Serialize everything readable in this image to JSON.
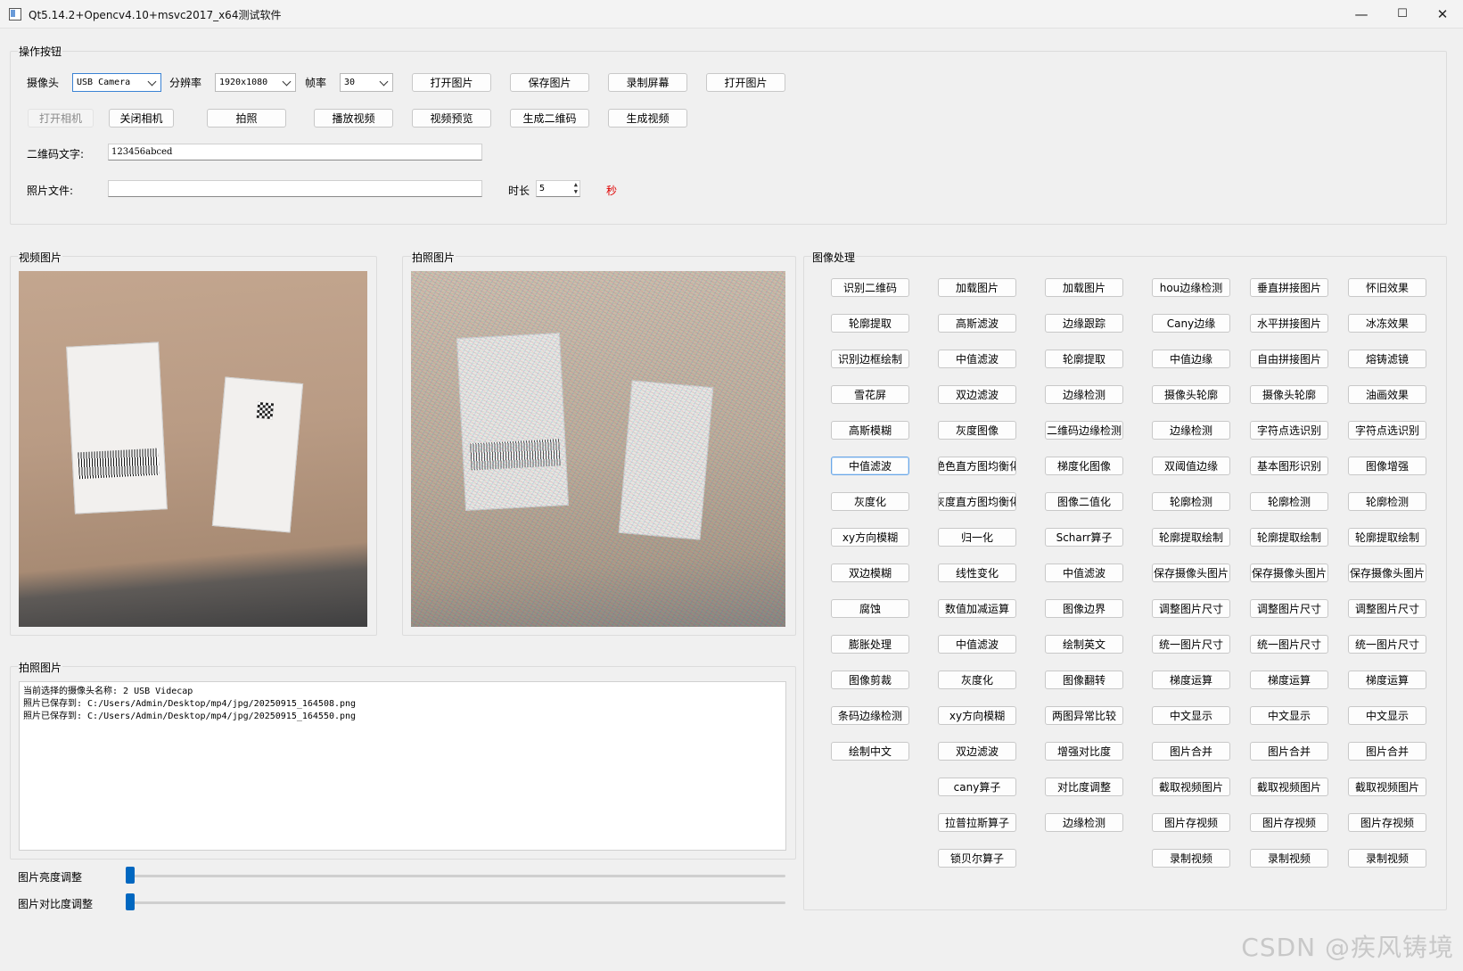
{
  "window": {
    "title": "Qt5.14.2+Opencv4.10+msvc2017_x64测试软件",
    "minimize": "—",
    "maximize": "☐",
    "close": "✕"
  },
  "ops": {
    "title": "操作按钮",
    "camera_label": "摄像头",
    "camera_value": "USB Camera",
    "resolution_label": "分辨率",
    "resolution_value": "1920x1080",
    "fps_label": "帧率",
    "fps_value": "30",
    "row1_buttons": [
      "打开图片",
      "保存图片",
      "录制屏幕",
      "打开图片"
    ],
    "row2_buttons": [
      "打开相机",
      "关闭相机",
      "拍照",
      "播放视频",
      "视频预览",
      "生成二维码",
      "生成视频"
    ],
    "qr_label": "二维码文字:",
    "qr_value": "123456abced",
    "photo_file_label": "照片文件:",
    "photo_file_value": "",
    "duration_label": "时长",
    "duration_value": "5",
    "seconds_label": "秒"
  },
  "video_panel": {
    "title": "视频图片"
  },
  "photo_panel": {
    "title": "拍照图片"
  },
  "log_panel": {
    "title": "拍照图片",
    "lines": [
      "当前选择的摄像头名称: 2 USB Videcap",
      "照片已保存到: C:/Users/Admin/Desktop/mp4/jpg/20250915_164508.png",
      "照片已保存到: C:/Users/Admin/Desktop/mp4/jpg/20250915_164550.png"
    ]
  },
  "sliders": {
    "brightness_label": "图片亮度调整",
    "contrast_label": "图片对比度调整",
    "brightness_value": 0,
    "contrast_value": 0
  },
  "image_processing": {
    "title": "图像处理",
    "columns": [
      [
        "识别二维码",
        "轮廓提取",
        "识别边框绘制",
        "雪花屏",
        "高斯模糊",
        "中值滤波",
        "灰度化",
        "xy方向模糊",
        "双边模糊",
        "腐蚀",
        "膨胀处理",
        "图像剪裁",
        "条码边缘检测",
        "绘制中文"
      ],
      [
        "加载图片",
        "高斯滤波",
        "中值滤波",
        "双边滤波",
        "灰度图像",
        "绝色直方图均衡化",
        "灰度直方图均衡化",
        "归一化",
        "线性变化",
        "数值加减运算",
        "中值滤波",
        "灰度化",
        "xy方向模糊",
        "双边滤波",
        "cany算子",
        "拉普拉斯算子",
        "锁贝尔算子"
      ],
      [
        "加载图片",
        "边缘跟踪",
        "轮廓提取",
        "边缘检测",
        "二维码边缘检测",
        "梯度化图像",
        "图像二值化",
        "Scharr算子",
        "中值滤波",
        "图像边界",
        "绘制英文",
        "图像翻转",
        "两图异常比较",
        "增强对比度",
        "对比度调整",
        "边缘检测"
      ],
      [
        "hou边缘检测",
        "Cany边缘",
        "中值边缘",
        "摄像头轮廓",
        "边缘检测",
        "双阈值边缘",
        "轮廓检测",
        "轮廓提取绘制",
        "保存摄像头图片",
        "调整图片尺寸",
        "统一图片尺寸",
        "梯度运算",
        "中文显示",
        "图片合并",
        "截取视频图片",
        "图片存视频",
        "录制视频"
      ],
      [
        "垂直拼接图片",
        "水平拼接图片",
        "自由拼接图片",
        "摄像头轮廓",
        "字符点选识别",
        "基本图形识别",
        "轮廓检测",
        "轮廓提取绘制",
        "保存摄像头图片",
        "调整图片尺寸",
        "统一图片尺寸",
        "梯度运算",
        "中文显示",
        "图片合并",
        "截取视频图片",
        "图片存视频",
        "录制视频"
      ],
      [
        "怀旧效果",
        "冰冻效果",
        "熔铸滤镜",
        "油画效果",
        "字符点选识别",
        "图像增强",
        "轮廓检测",
        "轮廓提取绘制",
        "保存摄像头图片",
        "调整图片尺寸",
        "统一图片尺寸",
        "梯度运算",
        "中文显示",
        "图片合并",
        "截取视频图片",
        "图片存视频",
        "录制视频"
      ]
    ]
  },
  "watermark": "CSDN @疾风铸境"
}
